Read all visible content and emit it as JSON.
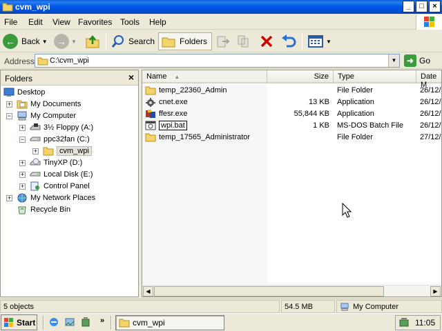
{
  "window": {
    "title": "cvm_wpi",
    "title_buttons": [
      "_",
      "□",
      "×"
    ]
  },
  "menu": [
    "File",
    "Edit",
    "View",
    "Favorites",
    "Tools",
    "Help"
  ],
  "toolbar": {
    "back": "Back",
    "search": "Search",
    "folders": "Folders"
  },
  "address": {
    "label": "Address",
    "value": "C:\\cvm_wpi",
    "go": "Go"
  },
  "folders_pane": {
    "title": "Folders",
    "items": [
      {
        "label": "Desktop"
      },
      {
        "label": "My Documents"
      },
      {
        "label": "My Computer"
      },
      {
        "label": "3½ Floppy (A:)"
      },
      {
        "label": "ppc32fan (C:)"
      },
      {
        "label": "cvm_wpi"
      },
      {
        "label": "TinyXP (D:)"
      },
      {
        "label": "Local Disk (E:)"
      },
      {
        "label": "Control Panel"
      },
      {
        "label": "My Network Places"
      },
      {
        "label": "Recycle Bin"
      }
    ]
  },
  "file_list": {
    "columns": [
      "Name",
      "Size",
      "Type",
      "Date M"
    ],
    "rows": [
      {
        "name": "temp_22360_Admin",
        "size": "",
        "type": "File Folder",
        "date": "26/12/"
      },
      {
        "name": "cnet.exe",
        "size": "13 KB",
        "type": "Application",
        "date": "26/12/"
      },
      {
        "name": "ffesr.exe",
        "size": "55,844 KB",
        "type": "Application",
        "date": "26/12/"
      },
      {
        "name": "wpi.bat",
        "size": "1 KB",
        "type": "MS-DOS Batch File",
        "date": "26/12/"
      },
      {
        "name": "temp_17565_Administrator",
        "size": "",
        "type": "File Folder",
        "date": "27/12/"
      }
    ]
  },
  "status": {
    "objects": "5 objects",
    "size": "54.5 MB",
    "location": "My Computer"
  },
  "taskbar": {
    "start": "Start",
    "more": "»",
    "task": "cvm_wpi",
    "clock": "11:05"
  },
  "colors": {
    "title_blue": "#0058e6",
    "folder_yellow": "#f4d36b",
    "delete_red": "#d40000"
  }
}
